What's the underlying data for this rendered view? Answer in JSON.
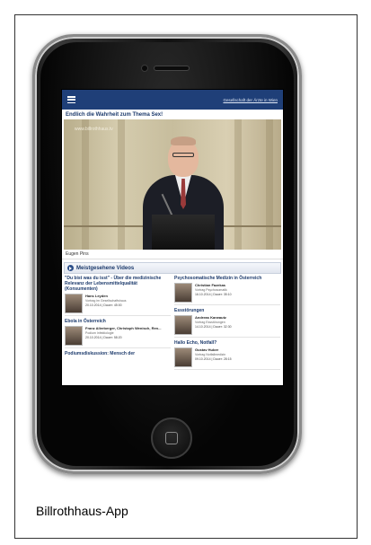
{
  "caption_label": "Billrothhaus-App",
  "app": {
    "org_link": "Gesellschaft der Ärzte in Wien",
    "headline": "Endlich die Wahrheit zum Thema Sex!",
    "video_watermark": "www.billrothhaus.tv",
    "video_caption": "Eugen Pins",
    "section_title": "Meistgesehene Videos",
    "left_items": [
      {
        "title": "\"Du bist was du isst\" - Über die medizinische Relevanz der Lebensmittelqualität (Konsumenten)",
        "name": "Hans Leyden",
        "desc": "Vortrag im Gesellschaftshaus",
        "date": "20.10.2014 | Dauer: 45:00"
      },
      {
        "title": "Ebola in Österreich",
        "name": "Franz Allerberger, Christoph Wenisch, Ren...",
        "desc": "Podium Infektiologie",
        "date": "20.10.2014 | Dauer: 58:20"
      }
    ],
    "left_more_title": "Podiumsdiskussion: Mensch der",
    "right_items": [
      {
        "title": "Psychosomatische Medizin in Österreich",
        "name": "Christian Fazekas",
        "desc": "Vortrag Psychosomatik",
        "date": "16.10.2014 | Dauer: 35:10"
      },
      {
        "title": "Essstörungen",
        "name": "Andreas Karwautz",
        "desc": "Vortrag Essstörungen",
        "date": "14.10.2014 | Dauer: 32:30"
      },
      {
        "title": "Hallo Echo, Notfall?",
        "name": "Gustav Huber",
        "desc": "Vortrag Notfallmedizin",
        "date": "09.10.2014 | Dauer: 28:15"
      }
    ]
  }
}
